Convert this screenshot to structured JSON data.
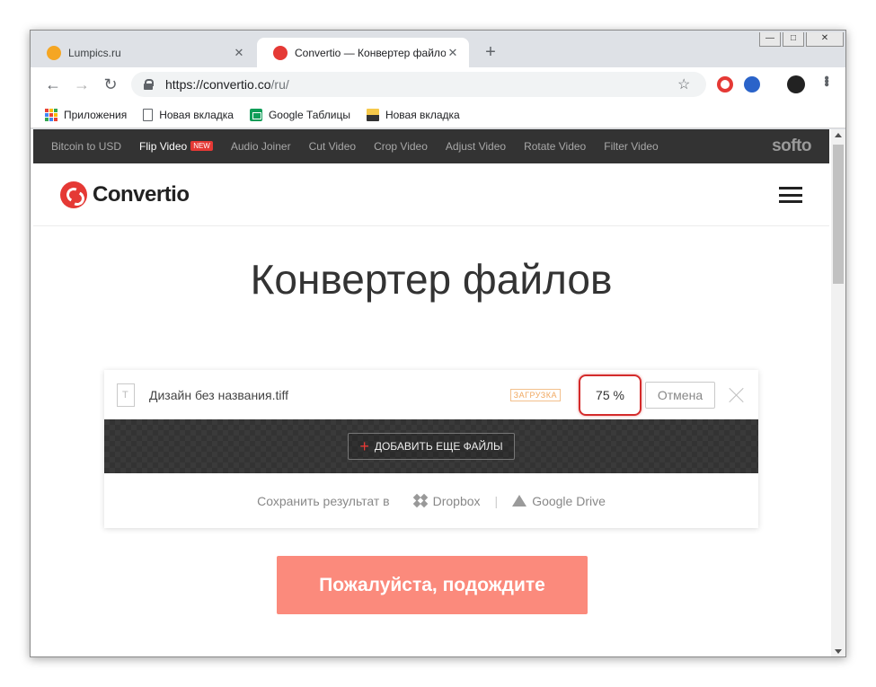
{
  "tabs": [
    {
      "title": "Lumpics.ru",
      "favicon_color": "#f5a623"
    },
    {
      "title": "Convertio — Конвертер файлов",
      "favicon_color": "#e53935"
    }
  ],
  "new_tab_label": "+",
  "window_controls": {
    "minimize": "—",
    "maximize": "□",
    "close": "✕"
  },
  "address_bar": {
    "host": "https://convertio.co",
    "path": "/ru/"
  },
  "bookmarks": [
    {
      "label": "Приложения",
      "icon": "apps-grid-icon"
    },
    {
      "label": "Новая вкладка",
      "icon": "page-icon"
    },
    {
      "label": "Google Таблицы",
      "icon": "sheets-icon"
    },
    {
      "label": "Новая вкладка",
      "icon": "image-icon"
    }
  ],
  "softo_nav": {
    "links": [
      "Bitcoin to USD",
      "Flip Video",
      "Audio Joiner",
      "Cut Video",
      "Crop Video",
      "Adjust Video",
      "Rotate Video",
      "Filter Video"
    ],
    "new_badge": "NEW",
    "brand": "softo"
  },
  "site": {
    "logo_text": "Convertio",
    "brand_color": "#e53935"
  },
  "hero_title": "Конвертер файлов",
  "file": {
    "name": "Дизайн без названия.tiff",
    "status": "ЗАГРУЗКА",
    "progress": "75 %",
    "cancel_label": "Отмена"
  },
  "add_files_label": "ДОБАВИТЬ ЕЩЕ ФАЙЛЫ",
  "save": {
    "label": "Сохранить результат в",
    "dropbox": "Dropbox",
    "gdrive": "Google Drive"
  },
  "wait_button": "Пожалуйста, подождите"
}
